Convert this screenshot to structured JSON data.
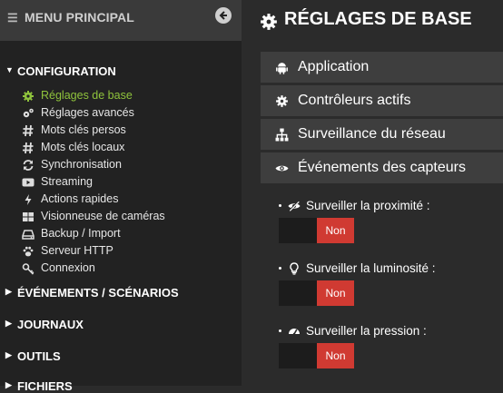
{
  "sidebar": {
    "header_title": "MENU PRINCIPAL",
    "sections": [
      {
        "label": "CONFIGURATION",
        "expanded": true
      },
      {
        "label": "ÉVÉNEMENTS / SCÉNARIOS",
        "expanded": false
      },
      {
        "label": "JOURNAUX",
        "expanded": false
      },
      {
        "label": "OUTILS",
        "expanded": false
      },
      {
        "label": "FICHIERS",
        "expanded": false
      }
    ],
    "items": [
      {
        "label": "Réglages de base",
        "icon": "gear-icon",
        "active": true
      },
      {
        "label": "Réglages avancés",
        "icon": "gears-icon"
      },
      {
        "label": "Mots clés persos",
        "icon": "hash-icon"
      },
      {
        "label": "Mots clés locaux",
        "icon": "hash-icon"
      },
      {
        "label": "Synchronisation",
        "icon": "sync-icon"
      },
      {
        "label": "Streaming",
        "icon": "play-icon"
      },
      {
        "label": "Actions rapides",
        "icon": "bolt-icon"
      },
      {
        "label": "Visionneuse de caméras",
        "icon": "grid-icon"
      },
      {
        "label": "Backup / Import",
        "icon": "drive-icon"
      },
      {
        "label": "Serveur HTTP",
        "icon": "paw-icon"
      },
      {
        "label": "Connexion",
        "icon": "key-icon"
      }
    ]
  },
  "main": {
    "title": "RÉGLAGES DE BASE",
    "accordion": [
      {
        "label": "Application",
        "icon": "android-icon"
      },
      {
        "label": "Contrôleurs actifs",
        "icon": "gear-icon"
      },
      {
        "label": "Surveillance du réseau",
        "icon": "sitemap-icon"
      },
      {
        "label": "Événements des capteurs",
        "icon": "eye-icon",
        "open": true
      }
    ],
    "settings": [
      {
        "label": "Surveiller la proximité :",
        "icon": "eye-slash-icon",
        "value": "Non"
      },
      {
        "label": "Surveiller la luminosité :",
        "icon": "lightbulb-icon",
        "value": "Non"
      },
      {
        "label": "Surveiller la pression :",
        "icon": "gauge-icon",
        "value": "Non"
      }
    ]
  },
  "colors": {
    "active_green": "#8fc33c",
    "toggle_red": "#d03a32",
    "sidebar_bg": "#222222",
    "main_bg": "#2b2b2b"
  }
}
